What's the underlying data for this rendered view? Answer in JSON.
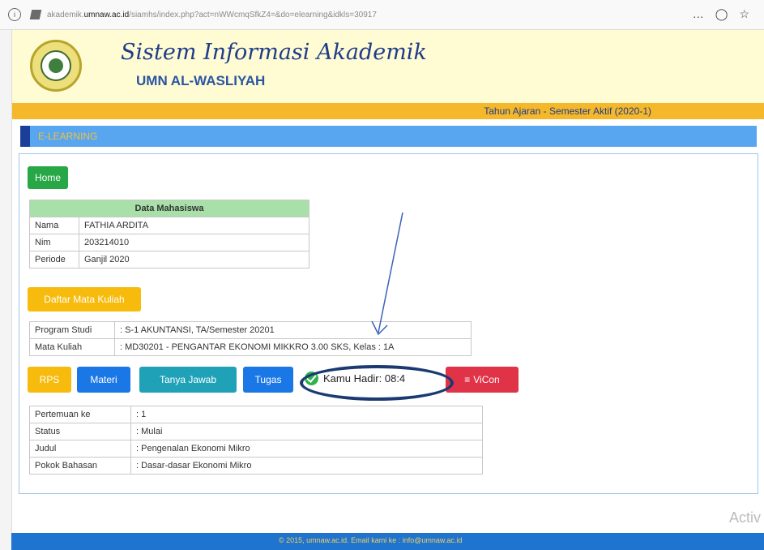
{
  "browser": {
    "url_prefix": "akademik.",
    "url_domain": "umnaw.ac.id",
    "url_rest": "/siamhs/index.php?act=nWWcmqSfkZ4=&do=elearning&idkls=30917",
    "menu_icon": "…"
  },
  "header": {
    "title": "Sistem Informasi Akademik",
    "subtitle": "UMN AL-WASLIYAH",
    "semester": "Tahun Ajaran - Semester Aktif (2020-1)"
  },
  "section": {
    "title": "E-LEARNING"
  },
  "buttons": {
    "home": "Home",
    "daftar": "Daftar Mata Kuliah",
    "rps": "RPS",
    "materi": "Materi",
    "tanya": "Tanya Jawab",
    "tugas": "Tugas",
    "hadir": "Kamu Hadir: 08:4",
    "vicon": "ViCon"
  },
  "mahasiswa": {
    "header": "Data Mahasiswa",
    "rows": [
      {
        "k": "Nama",
        "v": "FATHIA ARDITA"
      },
      {
        "k": "Nim",
        "v": "203214010"
      },
      {
        "k": "Periode",
        "v": "Ganjil 2020"
      }
    ]
  },
  "program": {
    "rows": [
      {
        "k": "Program Studi",
        "v": ": S-1 AKUNTANSI, TA/Semester 20201"
      },
      {
        "k": "Mata Kuliah",
        "v": ": MD30201 - PENGANTAR EKONOMI MIKKRO 3.00 SKS, Kelas : 1A"
      }
    ]
  },
  "pertemuan": {
    "rows": [
      {
        "k": "Pertemuan ke",
        "v": ": 1"
      },
      {
        "k": "Status",
        "v": ": Mulai"
      },
      {
        "k": "Judul",
        "v": ": Pengenalan Ekonomi Mikro"
      },
      {
        "k": "Pokok Bahasan",
        "v": ": Dasar-dasar Ekonomi Mikro"
      }
    ]
  },
  "footer": {
    "text": "© 2015, umnaw.ac.id. Email kami ke : info@umnaw.ac.id"
  },
  "overlay": {
    "activate": "Activ"
  },
  "colors": {
    "header_bg": "#fffbd3",
    "orange": "#f5b82a",
    "blue_bar": "#58a6f0",
    "footer": "#1f74cf",
    "annotation": "#1b3a72"
  }
}
